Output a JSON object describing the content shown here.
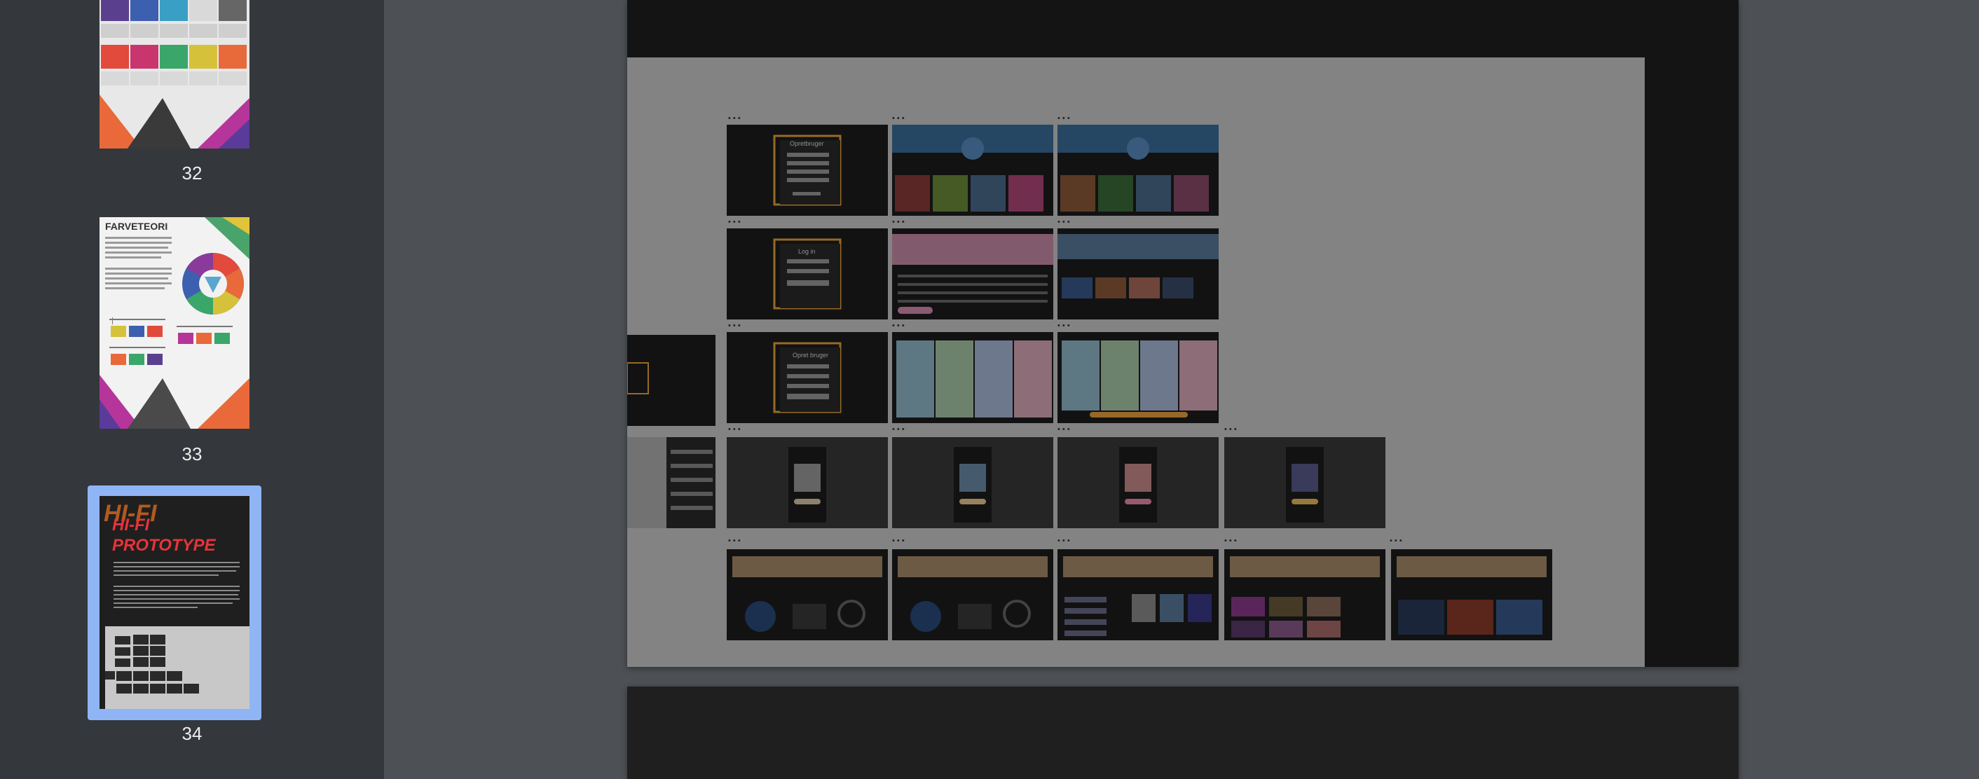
{
  "thumbnails": [
    {
      "page_number": "32"
    },
    {
      "page_number": "33",
      "title": "FARVETEORI"
    },
    {
      "page_number": "34",
      "title_shadow": "HI-FI",
      "title_line1": "HI-FI",
      "title_line2": "PROTOTYPE"
    }
  ],
  "selected_page": "34",
  "colors": {
    "sidebar_bg": "#34373b",
    "main_bg": "#4d5054",
    "selection_border": "#8fb5f5",
    "page_dark": "#1f1f1f",
    "canvas": "#c9c9c9",
    "accent_red": "#e8333a",
    "accent_orange": "#f08a24"
  },
  "canvas": {
    "frames_row1": [
      "Opretbruger",
      "",
      ""
    ],
    "frames_row2": [
      "Log in",
      "",
      ""
    ],
    "frames_row3": [
      "Opret bruger",
      "",
      ""
    ],
    "frame_marker": "•••"
  }
}
